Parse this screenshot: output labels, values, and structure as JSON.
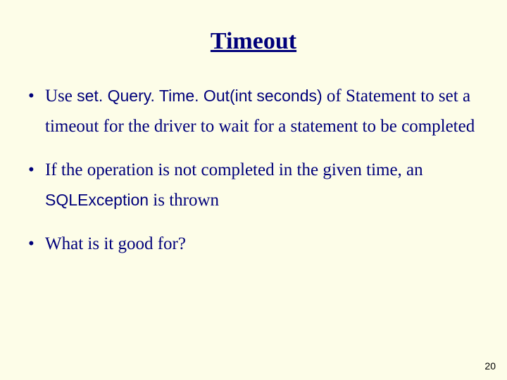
{
  "title": "Timeout",
  "bullets": {
    "b1": {
      "p1": "Use ",
      "code1": "set. Query. Time. Out(int seconds)",
      "p2": " of Statement to set a timeout for the driver to wait for a statement to be completed"
    },
    "b2": {
      "p1": "If the operation is not completed in the given time, an ",
      "code1": "SQLException",
      "p2": " is thrown"
    },
    "b3": {
      "p1": "What is it good for?"
    }
  },
  "page_number": "20"
}
